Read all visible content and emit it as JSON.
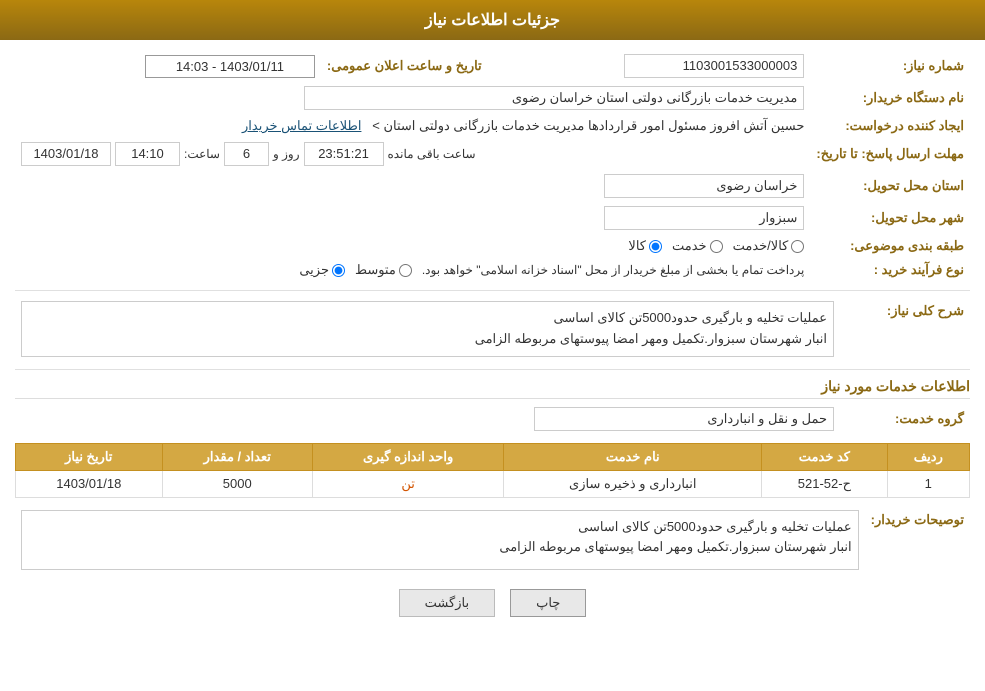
{
  "header": {
    "title": "جزئیات اطلاعات نیاز"
  },
  "fields": {
    "need_number_label": "شماره نیاز:",
    "need_number_value": "1103001533000003",
    "pub_date_label": "تاریخ و ساعت اعلان عمومی:",
    "pub_date_value": "1403/01/11 - 14:03",
    "buyer_org_label": "نام دستگاه خریدار:",
    "buyer_org_value": "مدیریت خدمات بازرگانی دولتی استان خراسان رضوی",
    "requester_label": "ایجاد کننده درخواست:",
    "requester_value": "حسین آتش افروز مسئول امور قراردادها مدیریت خدمات بازرگانی دولتی استان >",
    "contact_link": "اطلاعات تماس خریدار",
    "deadline_label": "مهلت ارسال پاسخ: تا تاریخ:",
    "deadline_date": "1403/01/18",
    "deadline_time_label": "ساعت:",
    "deadline_time": "14:10",
    "deadline_days_label": "روز و",
    "deadline_days": "6",
    "deadline_remaining_label": "ساعت باقی مانده",
    "deadline_remaining": "23:51:21",
    "province_label": "استان محل تحویل:",
    "province_value": "خراسان رضوی",
    "city_label": "شهر محل تحویل:",
    "city_value": "سبزوار",
    "category_label": "طبقه بندی موضوعی:",
    "category_options": [
      "کالا",
      "خدمت",
      "کالا/خدمت"
    ],
    "category_selected": "کالا",
    "purchase_type_label": "نوع فرآیند خرید :",
    "purchase_type_options": [
      "جزیی",
      "متوسط"
    ],
    "purchase_type_note": "پرداخت تمام یا بخشی از مبلغ خریدار از محل \"اسناد خزانه اسلامی\" خواهد بود.",
    "general_description_label": "شرح کلی نیاز:",
    "general_description": "عملیات تخلیه و بارگیری حدود5000تن کالای اساسی\nانبار شهرستان سبزوار.تکمیل ومهر امضا پیوستهای مربوطه الزامی",
    "service_info_title": "اطلاعات خدمات مورد نیاز",
    "service_group_label": "گروه خدمت:",
    "service_group_value": "حمل و نقل و انبارداری",
    "table": {
      "headers": [
        "ردیف",
        "کد خدمت",
        "نام خدمت",
        "واحد اندازه گیری",
        "تعداد / مقدار",
        "تاریخ نیاز"
      ],
      "rows": [
        {
          "row": "1",
          "service_code": "ح-52-521",
          "service_name": "انبارداری و ذخیره سازی",
          "unit": "تن",
          "quantity": "5000",
          "date": "1403/01/18"
        }
      ]
    },
    "buyer_desc_label": "توصیحات خریدار:",
    "buyer_desc_value": "عملیات تخلیه و بارگیری حدود5000تن کالای اساسی\nانبار شهرستان سبزوار.تکمیل ومهر امضا پیوستهای مربوطه الزامی"
  },
  "buttons": {
    "print": "چاپ",
    "back": "بازگشت"
  },
  "colors": {
    "header_bg": "#8b6914",
    "accent": "#d4a843",
    "link": "#1a5276",
    "orange": "#d35400"
  }
}
